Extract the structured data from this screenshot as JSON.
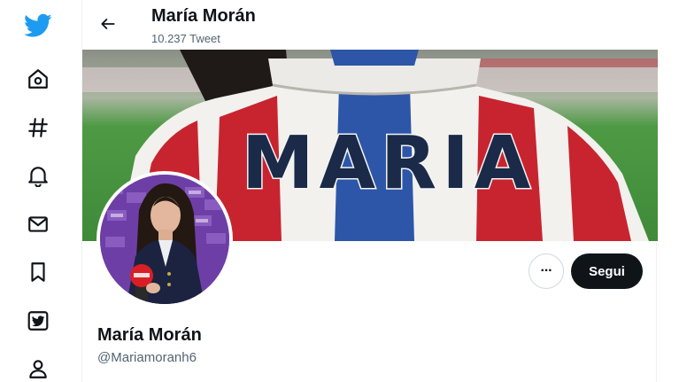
{
  "nav": {
    "items": [
      {
        "icon": "twitter-logo-icon"
      },
      {
        "icon": "home-icon"
      },
      {
        "icon": "hashtag-icon"
      },
      {
        "icon": "bell-icon"
      },
      {
        "icon": "mail-icon"
      },
      {
        "icon": "bookmark-icon"
      },
      {
        "icon": "twitter-blue-icon"
      },
      {
        "icon": "profile-icon"
      }
    ]
  },
  "header": {
    "name": "María Morán",
    "tweet_count": "10.237 Tweet"
  },
  "banner": {
    "shirt_text": "MARIA"
  },
  "actions": {
    "more_label": "···",
    "follow_label": "Segui"
  },
  "profile": {
    "name": "María Morán",
    "handle": "@Mariamoranh6"
  },
  "colors": {
    "brand": "#1d9bf0",
    "text": "#0f1419",
    "secondary_text": "#536471",
    "button_dark": "#0f1419"
  }
}
